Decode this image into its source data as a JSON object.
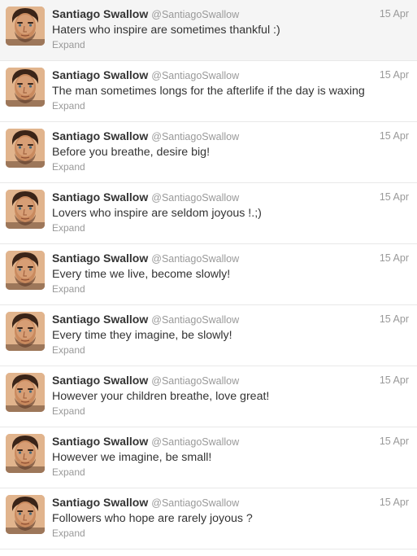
{
  "timeline": {
    "tweets": [
      {
        "name": "Santiago Swallow",
        "handle": "@SantiagoSwallow",
        "time": "15 Apr",
        "text": "Haters who inspire are sometimes thankful :)",
        "expand": "Expand"
      },
      {
        "name": "Santiago Swallow",
        "handle": "@SantiagoSwallow",
        "time": "15 Apr",
        "text": "The man sometimes longs for the afterlife if the day is waxing",
        "expand": "Expand"
      },
      {
        "name": "Santiago Swallow",
        "handle": "@SantiagoSwallow",
        "time": "15 Apr",
        "text": "Before you breathe, desire big!",
        "expand": "Expand"
      },
      {
        "name": "Santiago Swallow",
        "handle": "@SantiagoSwallow",
        "time": "15 Apr",
        "text": "Lovers who inspire are seldom joyous !.;)",
        "expand": "Expand"
      },
      {
        "name": "Santiago Swallow",
        "handle": "@SantiagoSwallow",
        "time": "15 Apr",
        "text": "Every time we live, become slowly!",
        "expand": "Expand"
      },
      {
        "name": "Santiago Swallow",
        "handle": "@SantiagoSwallow",
        "time": "15 Apr",
        "text": "Every time they imagine, be slowly!",
        "expand": "Expand"
      },
      {
        "name": "Santiago Swallow",
        "handle": "@SantiagoSwallow",
        "time": "15 Apr",
        "text": "However your children breathe, love great!",
        "expand": "Expand"
      },
      {
        "name": "Santiago Swallow",
        "handle": "@SantiagoSwallow",
        "time": "15 Apr",
        "text": "However we imagine, be small!",
        "expand": "Expand"
      },
      {
        "name": "Santiago Swallow",
        "handle": "@SantiagoSwallow",
        "time": "15 Apr",
        "text": "Followers who hope are rarely joyous ?",
        "expand": "Expand"
      }
    ]
  },
  "colors": {
    "name": "#333333",
    "meta": "#999999",
    "divider": "#e8e8e8"
  },
  "icons": {
    "avatar": "profile-photo"
  }
}
